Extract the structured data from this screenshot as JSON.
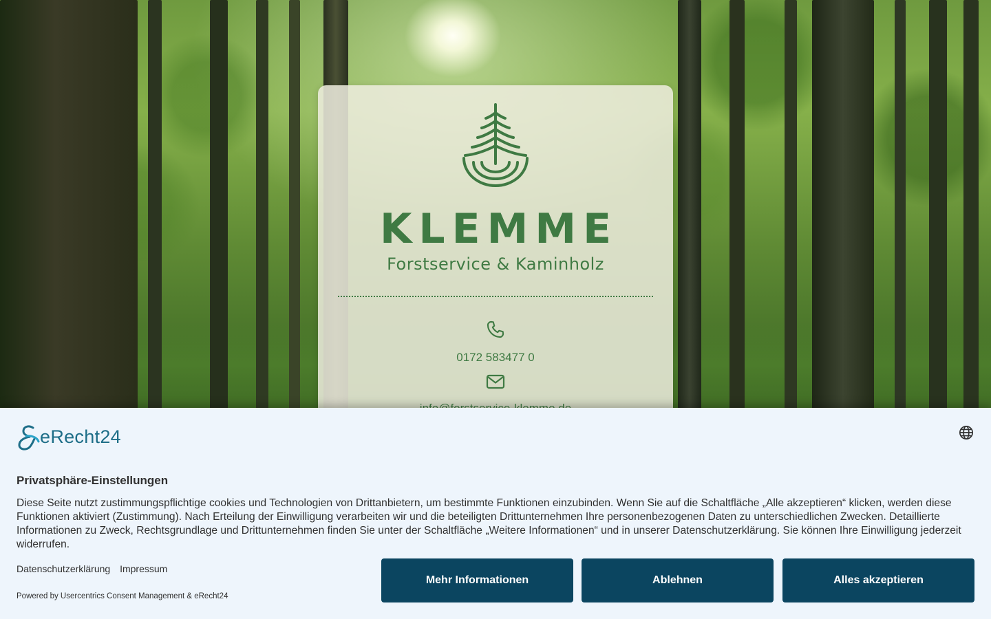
{
  "page": {
    "brand_name": "KLEMME",
    "tagline": "Forstservice & Kaminholz",
    "phone": "0172 583477 0",
    "email": "info@forstservice-klemme.de"
  },
  "icons": {
    "logo": "pine-tree-logo-icon",
    "phone": "phone-icon",
    "email": "envelope-icon",
    "language": "globe-icon",
    "consent_logo": "erecht24-logo-icon"
  },
  "colors": {
    "brand_green": "#3f7a43",
    "consent_bg": "#eef5fc",
    "button_bg": "#0b4560",
    "erecht_blue": "#1e6e88"
  },
  "consent": {
    "logo_text": "eRecht24",
    "title": "Privatsphäre-Einstellungen",
    "body": "Diese Seite nutzt zustimmungspflichtige cookies und Technologien von Drittanbietern, um bestimmte Funktionen einzubinden. Wenn Sie auf die Schaltfläche „Alle akzeptieren“ klicken, werden diese Funktionen aktiviert (Zustimmung). Nach Erteilung der Einwilligung verarbeiten wir und die beteiligten Drittunternehmen Ihre personenbezogenen Daten zu unterschiedlichen Zwecken. Detaillierte Informationen zu Zweck, Rechtsgrundlage und Drittunternehmen finden Sie unter der Schaltfläche „Weitere Informationen“ und in unserer Datenschutzerklärung. Sie können Ihre Einwilligung jederzeit widerrufen.",
    "link_privacy": "Datenschutzerklärung",
    "link_imprint": "Impressum",
    "powered_by": "Powered by Usercentrics Consent Management & eRecht24",
    "btn_more": "Mehr Informationen",
    "btn_deny": "Ablehnen",
    "btn_accept": "Alles akzeptieren"
  }
}
